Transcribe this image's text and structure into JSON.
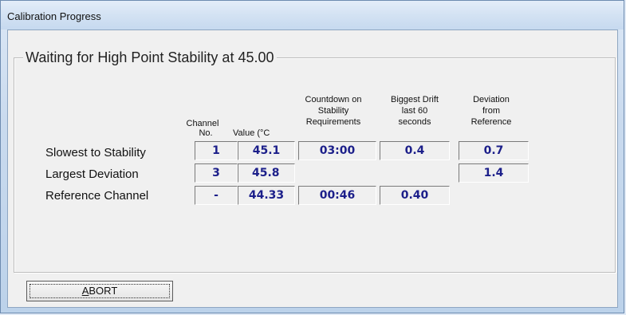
{
  "window": {
    "title": "Calibration Progress"
  },
  "group": {
    "title": "Waiting for High Point Stability at 45.00"
  },
  "columns": {
    "channel": [
      "Channel",
      "No."
    ],
    "value": "Value (°C",
    "countdown": [
      "Countdown on",
      "Stability",
      "Requirements"
    ],
    "drift": [
      "Biggest Drift",
      "last 60",
      "seconds"
    ],
    "deviation": [
      "Deviation",
      "from",
      "Reference"
    ]
  },
  "rows": [
    {
      "label": "Slowest to Stability",
      "channel": "1",
      "value": "45.1",
      "countdown": "03:00",
      "drift": "0.4",
      "deviation": "0.7"
    },
    {
      "label": "Largest Deviation",
      "channel": "3",
      "value": "45.8",
      "deviation": "1.4"
    },
    {
      "label": "Reference Channel",
      "channel": "-",
      "value": "44.33",
      "countdown": "00:46",
      "drift": "0.40"
    }
  ],
  "buttons": {
    "abort_prefix": "",
    "abort_mnemonic": "A",
    "abort_rest": "BORT"
  }
}
